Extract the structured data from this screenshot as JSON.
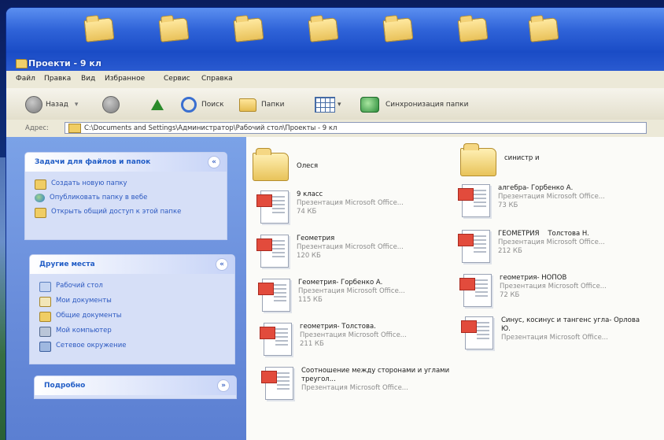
{
  "window": {
    "title": "Проекти - 9 кл"
  },
  "menu": [
    "Файл",
    "Правка",
    "Вид",
    "Избранное",
    "Сервис",
    "Справка"
  ],
  "toolbar": {
    "back_label": "Назад",
    "search_label": "Поиск",
    "folders_label": "Папки",
    "sync_label": "Синхронизация папки"
  },
  "address": {
    "label": "Адрес:",
    "path": "C:\\Documents and Settings\\Администратор\\Рабочий стол\\Проекты - 9 кл"
  },
  "tasks_panel": {
    "title": "Задачи для файлов и папок",
    "items": [
      {
        "label": "Создать новую папку",
        "icon": "new-folder-icon"
      },
      {
        "label": "Опубликовать папку в вебе",
        "icon": "publish-web-icon"
      },
      {
        "label": "Открыть общий доступ к этой папке",
        "icon": "share-folder-icon"
      }
    ]
  },
  "places_panel": {
    "title": "Другие места",
    "items": [
      {
        "label": "Рабочий стол",
        "icon": "desktop-icon"
      },
      {
        "label": "Мои документы",
        "icon": "my-documents-icon"
      },
      {
        "label": "Общие документы",
        "icon": "shared-documents-icon"
      },
      {
        "label": "Мой компьютер",
        "icon": "my-computer-icon"
      },
      {
        "label": "Сетевое окружение",
        "icon": "network-icon"
      }
    ]
  },
  "details_panel": {
    "title": "Подробно"
  },
  "files": [
    {
      "name": "Олеся",
      "kind": "folder"
    },
    {
      "name": "синистр и",
      "kind": "folder"
    },
    {
      "name": "9 класс",
      "type": "Презентация Microsoft Office...",
      "size": "74 КБ",
      "kind": "ppt"
    },
    {
      "name": "алгебра- Горбенко А.",
      "type": "Презентация Microsoft Office...",
      "size": "73 КБ",
      "kind": "ppt"
    },
    {
      "name": "Геометрия",
      "type": "Презентация Microsoft Office...",
      "size": "120 КБ",
      "kind": "ppt"
    },
    {
      "name": "ГЕОМЕТРИЯ    Толстова Н.",
      "type": "Презентация Microsoft Office...",
      "size": "212 КБ",
      "kind": "ppt"
    },
    {
      "name": "Геометрия- Горбенко А.",
      "type": "Презентация Microsoft Office...",
      "size": "115 КБ",
      "kind": "ppt"
    },
    {
      "name": "геометрия- НОПОВ",
      "type": "Презентация Microsoft Office...",
      "size": "72 КБ",
      "kind": "ppt"
    },
    {
      "name": "геометрия- Толстова.",
      "type": "Презентация Microsoft Office...",
      "size": "211 КБ",
      "kind": "ppt"
    },
    {
      "name": "Синус, косинус и тангенс угла- Орлова Ю.",
      "type": "Презентация Microsoft Office...",
      "size": "",
      "kind": "ppt"
    },
    {
      "name": "Соотношение между сторонами и углами треугол...",
      "type": "Презентация Microsoft Office...",
      "size": "",
      "kind": "ppt"
    }
  ]
}
